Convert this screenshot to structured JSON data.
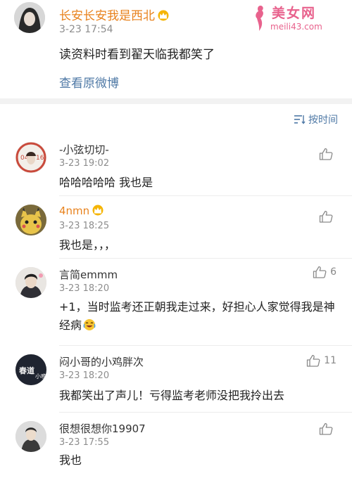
{
  "post": {
    "author": "长安长安我是西北",
    "time": "3-23 17:54",
    "text": "读资料时看到翟天临我都笑了",
    "view_original": "查看原微博"
  },
  "watermark": {
    "brand": "美女网",
    "url": "meili43.com"
  },
  "sort": {
    "label": "按时间"
  },
  "comments": [
    {
      "name": "-小弦切切-",
      "time": "3-23 19:02",
      "text": "哈哈哈哈哈 我也是",
      "likes": ""
    },
    {
      "name": "4nmn",
      "time": "3-23 18:25",
      "text": "我也是，，，",
      "likes": ""
    },
    {
      "name": "言简emmm",
      "time": "3-23 18:20",
      "text": "+1，当时监考还正朝我走过来，好担心人家觉得我是神经病",
      "likes": "6"
    },
    {
      "name": "闷小哥的小鸡胖次",
      "time": "3-23 18:20",
      "text": "我都笑出了声儿！亏得监考老师没把我拎出去",
      "likes": "11"
    },
    {
      "name": "很想很想你19907",
      "time": "3-23 17:55",
      "text": "我也",
      "likes": ""
    }
  ],
  "colors": {
    "vip_name": "#e8821d",
    "link": "#4f79a6",
    "time": "#8d8d8d",
    "watermark": "#e8628d"
  }
}
